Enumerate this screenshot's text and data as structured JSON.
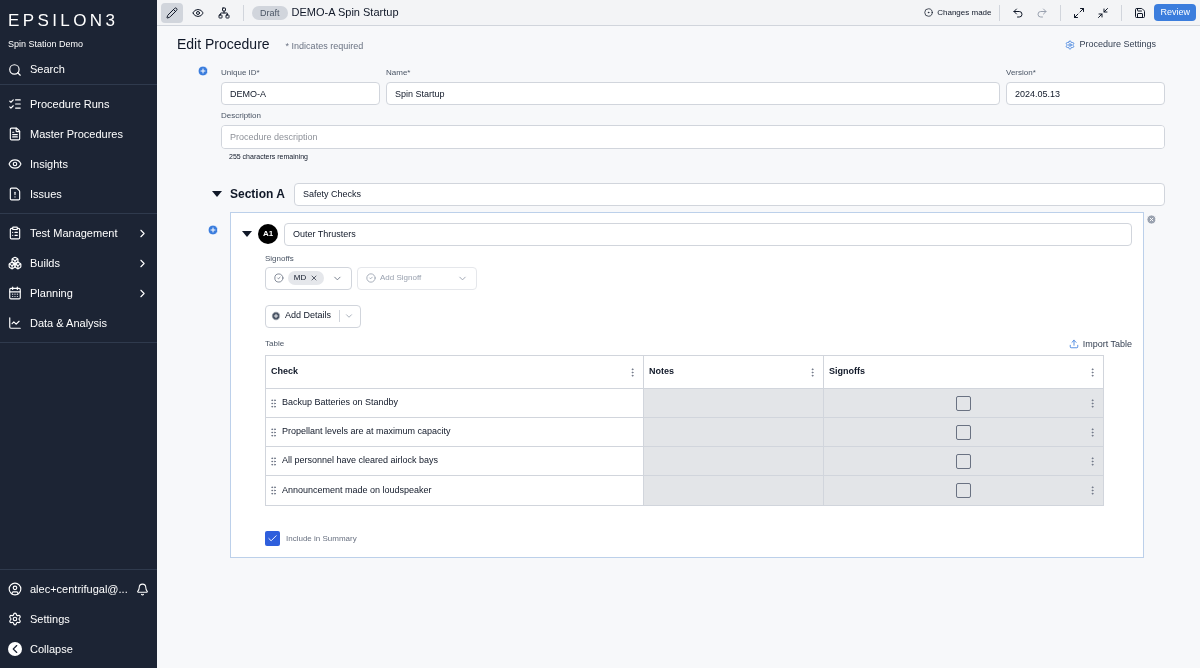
{
  "sidebar": {
    "logo": "EPSILON3",
    "workspace": "Spin Station Demo",
    "search": "Search",
    "groups": [
      [
        {
          "label": "Procedure Runs",
          "has_submenu": false
        },
        {
          "label": "Master Procedures",
          "has_submenu": false
        },
        {
          "label": "Insights",
          "has_submenu": false
        },
        {
          "label": "Issues",
          "has_submenu": false
        }
      ],
      [
        {
          "label": "Test Management",
          "has_submenu": true
        },
        {
          "label": "Builds",
          "has_submenu": true
        },
        {
          "label": "Planning",
          "has_submenu": true
        },
        {
          "label": "Data & Analysis",
          "has_submenu": false
        }
      ]
    ],
    "user": "alec+centrifugal@...",
    "settings": "Settings",
    "collapse": "Collapse"
  },
  "toolbar": {
    "modes": [
      {
        "selected": true
      },
      {
        "selected": false
      },
      {
        "selected": false
      }
    ],
    "badge": "Draft",
    "title": "DEMO-A Spin Startup",
    "status": "Changes made",
    "redo_disabled": true,
    "review": "Review"
  },
  "header": {
    "title": "Edit Procedure",
    "note": "* Indicates required",
    "settings": "Procedure Settings"
  },
  "fields": {
    "unique_id": {
      "label": "Unique ID*",
      "value": "DEMO-A"
    },
    "name": {
      "label": "Name*",
      "value": "Spin Startup"
    },
    "version": {
      "label": "Version*",
      "value": "2024.05.13"
    },
    "description": {
      "label": "Description",
      "placeholder": "Procedure description",
      "remaining": "255 characters remaining"
    }
  },
  "section": {
    "label": "Section A",
    "name": "Safety Checks",
    "expanded": true,
    "step": {
      "badge": "A1",
      "name": "Outer Thrusters",
      "expanded": true,
      "signoffs_label": "Signoffs",
      "signoffs": [
        "MD"
      ],
      "add_signoff": "Add Signoff",
      "add_details": "Add Details",
      "table": {
        "label": "Table",
        "import": "Import Table",
        "columns": [
          "Check",
          "Notes",
          "Signoffs"
        ],
        "rows": [
          {
            "check": "Backup Batteries on Standby",
            "checked": false
          },
          {
            "check": "Propellant levels are at maximum capacity",
            "checked": false
          },
          {
            "check": "All personnel have cleared airlock bays",
            "checked": false
          },
          {
            "check": "Announcement made on loudspeaker",
            "checked": false
          }
        ]
      },
      "include_summary": {
        "label": "Include in Summary",
        "checked": true
      }
    }
  }
}
